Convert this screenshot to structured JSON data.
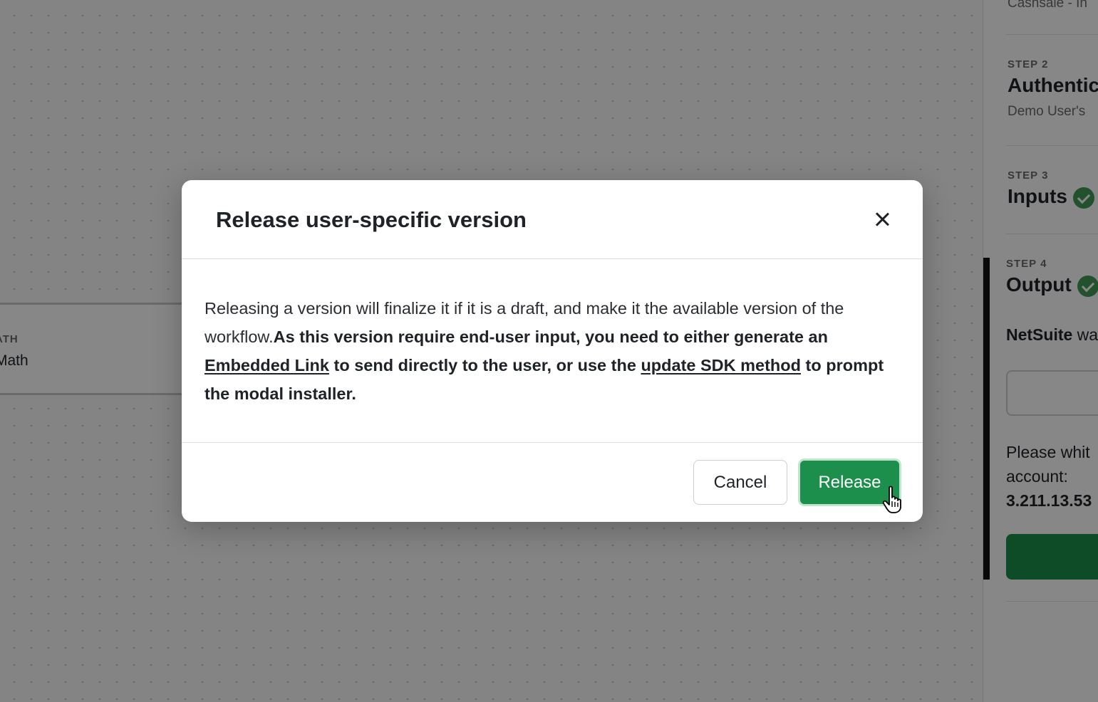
{
  "canvas": {
    "node": {
      "type_label": "ATH",
      "name": "Math"
    }
  },
  "panel": {
    "top_subtitle": "Cashsale - In",
    "steps": [
      {
        "label": "STEP 2",
        "title": "Authentic",
        "desc": "Demo User's"
      },
      {
        "label": "STEP 3",
        "title": "Inputs",
        "completed": true
      },
      {
        "label": "STEP 4",
        "title": "Output",
        "completed": true
      }
    ],
    "netsuite_bold": "NetSuite",
    "netsuite_rest": " wa",
    "whitelist_line1": "Please whit",
    "whitelist_line2": "account:",
    "whitelist_ip": "3.211.13.53"
  },
  "modal": {
    "title": "Release user-specific version",
    "body": {
      "text1": "Releasing a version will finalize it if it is a draft, and make it the available version of the workflow.",
      "text2_bold": "As this version require end-user input, you need to either generate an ",
      "link1": "Embedded Link",
      "text3_bold": " to send directly to the user, or use the ",
      "link2": "update SDK method",
      "text4_bold": " to prompt the modal installer."
    },
    "cancel_label": "Cancel",
    "release_label": "Release"
  },
  "colors": {
    "primary_green": "#1b8f4b",
    "check_green": "#3f9b55",
    "overlay": "rgba(0,0,0,0.47)"
  }
}
